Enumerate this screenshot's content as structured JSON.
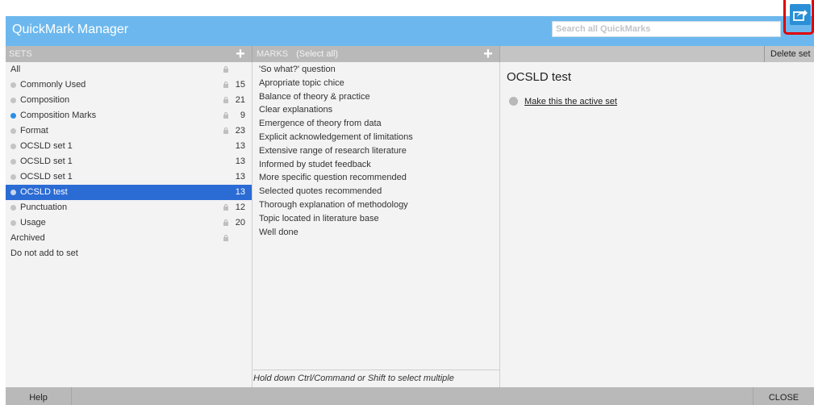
{
  "window": {
    "title": "QuickMark Manager"
  },
  "search": {
    "placeholder": "Search all QuickMarks",
    "value": ""
  },
  "toolbar": {
    "export_icon": "export-icon"
  },
  "sets": {
    "header": "SETS",
    "items": [
      {
        "name": "All",
        "count": "",
        "locked": true,
        "bullet": "none",
        "selected": false
      },
      {
        "name": "Commonly Used",
        "count": "15",
        "locked": true,
        "bullet": "gray",
        "selected": false
      },
      {
        "name": "Composition",
        "count": "21",
        "locked": true,
        "bullet": "gray",
        "selected": false
      },
      {
        "name": "Composition Marks",
        "count": "9",
        "locked": true,
        "bullet": "blue",
        "selected": false
      },
      {
        "name": "Format",
        "count": "23",
        "locked": true,
        "bullet": "gray",
        "selected": false
      },
      {
        "name": "OCSLD set 1",
        "count": "13",
        "locked": false,
        "bullet": "gray",
        "selected": false
      },
      {
        "name": "OCSLD set 1",
        "count": "13",
        "locked": false,
        "bullet": "gray",
        "selected": false
      },
      {
        "name": "OCSLD set 1",
        "count": "13",
        "locked": false,
        "bullet": "gray",
        "selected": false
      },
      {
        "name": "OCSLD test",
        "count": "13",
        "locked": false,
        "bullet": "gray",
        "selected": true
      },
      {
        "name": "Punctuation",
        "count": "12",
        "locked": true,
        "bullet": "gray",
        "selected": false
      },
      {
        "name": "Usage",
        "count": "20",
        "locked": true,
        "bullet": "gray",
        "selected": false
      },
      {
        "name": "Archived",
        "count": "",
        "locked": true,
        "bullet": "none",
        "selected": false
      },
      {
        "name": "Do not add to set",
        "count": "",
        "locked": false,
        "bullet": "none",
        "selected": false
      }
    ]
  },
  "marks": {
    "header": "MARKS",
    "select_all": "(Select all)",
    "items": [
      "'So what?' question",
      "Apropriate topic chice",
      "Balance of theory & practice",
      "Clear explanations",
      "Emergence of theory from data",
      "Explicit acknowledgement of limitations",
      "Extensive range of research literature",
      "Informed by studet feedback",
      "More specific question recommended",
      "Selected quotes recommended",
      "Thorough explanation of methodology",
      "Topic located in literature base",
      "Well done"
    ],
    "hint": "Hold down Ctrl/Command or Shift to select multiple"
  },
  "detail": {
    "delete_label": "Delete set",
    "title": "OCSLD test",
    "make_active": "Make this the active set"
  },
  "footer": {
    "help": "Help",
    "close": "CLOSE"
  },
  "colors": {
    "titlebar": "#6cb8ee",
    "selected_row": "#2b6bd4",
    "highlight_box": "#e00000",
    "export_button": "#2a8fd6"
  }
}
